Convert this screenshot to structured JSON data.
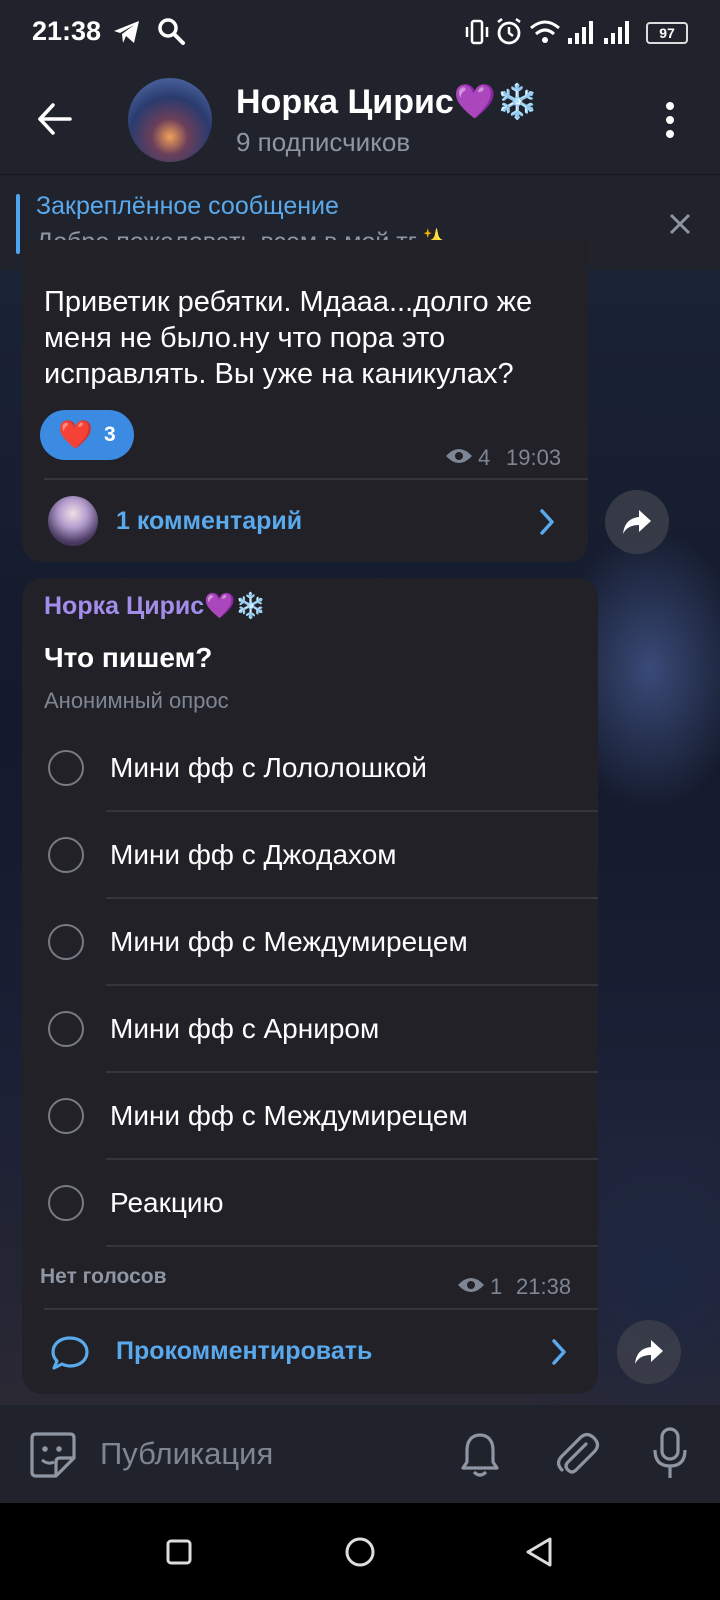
{
  "status_bar": {
    "time": "21:38",
    "battery": "97"
  },
  "header": {
    "title": "Норка Цирис💜❄️",
    "subtitle": "9 подписчиков"
  },
  "pinned": {
    "label": "Закреплённое сообщение",
    "text": "Добро пожаловать всем в мой тг✨"
  },
  "message1": {
    "text": "Приветик ребятки. Мдааа...долго же меня не было.ну что пора это исправлять. Вы уже на каникулах?",
    "reaction_emoji": "❤️",
    "reaction_count": "3",
    "views": "4",
    "time": "19:03",
    "comments_label": "1 комментарий"
  },
  "poll": {
    "author": "Норка Цирис💜❄️",
    "question": "Что пишем?",
    "type": "Анонимный опрос",
    "options": [
      "Мини фф с Лололошкой",
      "Мини фф с Джодахом",
      "Мини фф с Междумирецем",
      "Мини фф с Арниром",
      "Мини фф с Междумирецем",
      "Реакцию"
    ],
    "votes_label": "Нет голосов",
    "views": "1",
    "time": "21:38",
    "comment_label": "Прокомментировать"
  },
  "input": {
    "placeholder": "Публикация"
  },
  "icons": {
    "accent_color": "#5aa9ec",
    "author_color": "#a18dea",
    "reaction_color": "#3b8be2"
  }
}
